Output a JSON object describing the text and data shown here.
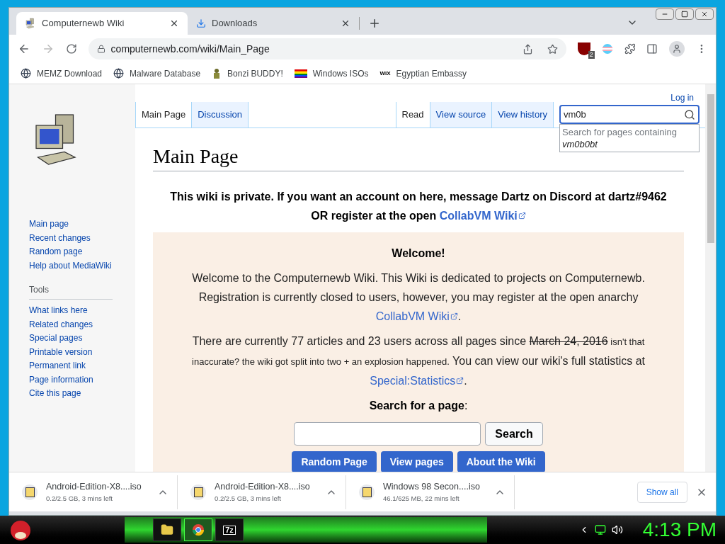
{
  "tabs": [
    {
      "title": "Computernewb Wiki",
      "selected": true
    },
    {
      "title": "Downloads",
      "selected": false
    }
  ],
  "address": "computernewb.com/wiki/Main_Page",
  "extension_badge": "2",
  "bookmarks": [
    {
      "label": "MEMZ Download",
      "kind": "globe"
    },
    {
      "label": "Malware Database",
      "kind": "globe"
    },
    {
      "label": "Bonzi BUDDY!",
      "kind": "figure"
    },
    {
      "label": "Windows ISOs",
      "kind": "flag"
    },
    {
      "label": "Egyptian Embassy",
      "kind": "logo"
    }
  ],
  "wix_mark": "WIX",
  "login": "Log in",
  "sidebar": {
    "nav": [
      "Main page",
      "Recent changes",
      "Random page",
      "Help about MediaWiki"
    ],
    "tools_heading": "Tools",
    "tools": [
      "What links here",
      "Related changes",
      "Special pages",
      "Printable version",
      "Permanent link",
      "Page information",
      "Cite this page"
    ]
  },
  "page_tabs": [
    {
      "label": "Main Page",
      "selected": true
    },
    {
      "label": "Discussion",
      "selected": false
    }
  ],
  "view_tabs": [
    {
      "label": "Read",
      "selected": true
    },
    {
      "label": "View source",
      "selected": false
    },
    {
      "label": "View history",
      "selected": false
    }
  ],
  "search": {
    "value": "vm0b",
    "suggestion_label": "Search for pages containing",
    "suggestion_term": "vm0b0bt"
  },
  "heading": "Main Page",
  "notice": [
    {
      "kind": "text",
      "text": "This wiki is private. If you want an account on here, message Dartz on Discord at dartz#9462 OR register at the open "
    },
    {
      "kind": "link",
      "text": "CollabVM Wiki"
    }
  ],
  "welcome": {
    "title": "Welcome!",
    "paragraphs": [
      [
        {
          "kind": "text",
          "text": "Welcome to the Computernewb Wiki. This Wiki is dedicated to projects on Computernewb. Registration is currently closed to users, however, you may register at the open anarchy "
        },
        {
          "kind": "link",
          "text": "CollabVM Wiki"
        },
        {
          "kind": "text",
          "text": "."
        }
      ],
      [
        {
          "kind": "text",
          "text": "There are currently 77 articles and 23 users across all pages since "
        },
        {
          "kind": "strike",
          "text": "March 24, 2016"
        },
        {
          "kind": "small",
          "text": " isn't that inaccurate? the wiki got split into two + an explosion happened."
        },
        {
          "kind": "text",
          "text": " You can view our wiki's full statistics at "
        },
        {
          "kind": "link",
          "text": "Special:Statistics"
        },
        {
          "kind": "text",
          "text": "."
        }
      ]
    ],
    "search_label": "Search for a page",
    "search_colon": ":",
    "search_button": "Search",
    "buttons": [
      "Random Page",
      "View pages",
      "About the Wiki"
    ]
  },
  "downloads": [
    {
      "name": "Android-Edition-X8....iso",
      "status": "0.2/2.5 GB, 3 mins left"
    },
    {
      "name": "Android-Edition-X8....iso",
      "status": "0.2/2.5 GB, 3 mins left"
    },
    {
      "name": "Windows 98 Secon....iso",
      "status": "46.1/625 MB, 22 mins left"
    }
  ],
  "show_all": "Show all",
  "taskbar": {
    "apps": [
      {
        "kind": "folder",
        "selected": false
      },
      {
        "kind": "browser",
        "selected": true
      },
      {
        "kind": "archive",
        "label": "7z",
        "selected": false
      }
    ],
    "clock": "4:13 PM"
  }
}
